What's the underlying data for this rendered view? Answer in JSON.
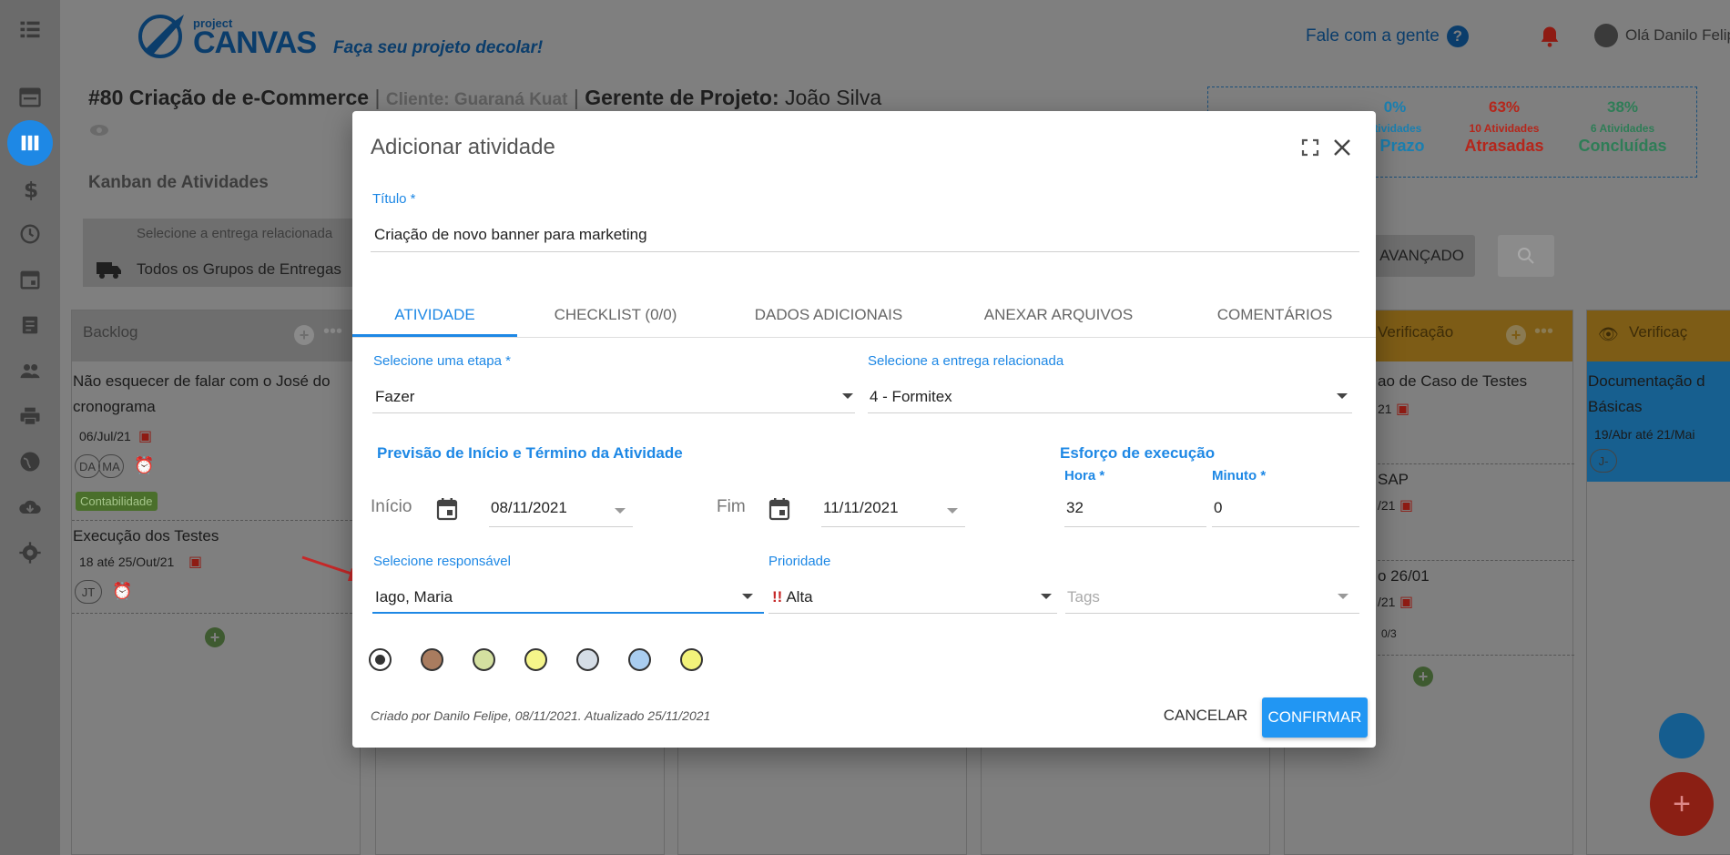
{
  "header": {
    "logo_small": "project",
    "logo_big": "CANVAS",
    "tagline": "Faça seu projeto decolar!",
    "contact": "Fale com a gente",
    "contact_icon": "help-circle-icon",
    "user": "Olá Danilo Felipe"
  },
  "project": {
    "number_title": "#80 Criação de e-Commerce",
    "client": "Cliente: Guaraná Kuat",
    "manager_label": "Gerente de Projeto:",
    "manager_name": "João Silva",
    "kanban_label": "Kanban de Atividades",
    "filter_label": "Selecione a entrega relacionada",
    "filter_value": "Todos os Grupos de Entregas"
  },
  "stats": [
    {
      "pct": "0%",
      "sub": "atividades",
      "label": "o Prazo",
      "color": "#1a7fb0"
    },
    {
      "pct": "63%",
      "sub": "10 Atividades",
      "label": "Atrasadas",
      "color": "#b5261b"
    },
    {
      "pct": "38%",
      "sub": "6 Atividades",
      "label": "Concluídas",
      "color": "#2f7d57"
    }
  ],
  "toolbar": {
    "advanced": "AVANÇADO"
  },
  "columns": {
    "backlog": {
      "title": "Backlog",
      "card1_line1": "Não esquecer de falar com o José do",
      "card1_line2": "cronograma",
      "card1_date": "06/Jul/21",
      "card1_avatar1": "DA",
      "card1_avatar2": "MA",
      "card1_tag": "Contabilidade",
      "card2_title": "Execução dos Testes",
      "card2_date": "18 até 25/Out/21",
      "card2_avatar": "JT"
    },
    "verificacao": {
      "title": "Verificação",
      "card1": "ao de Caso de Testes",
      "card1_date": "21",
      "card2": "SAP",
      "card2_date": "/21",
      "card3": "o 26/01",
      "card3_date": "/21",
      "card3_progress": "0/3"
    },
    "verificacao2": {
      "title": "Verificaç",
      "card1_line1": "Documentação d",
      "card1_line2": "Básicas",
      "card1_date": "19/Abr até 21/Mai",
      "card1_avatar": "J-"
    }
  },
  "modal": {
    "title": "Adicionar atividade",
    "titulo_label": "Título *",
    "titulo_value": "Criação de novo banner para marketing",
    "tabs": [
      "ATIVIDADE",
      "CHECKLIST (0/0)",
      "DADOS ADICIONAIS",
      "ANEXAR ARQUIVOS",
      "COMENTÁRIOS"
    ],
    "etapa_label": "Selecione uma etapa *",
    "etapa_value": "Fazer",
    "entrega_label": "Selecione a entrega relacionada",
    "entrega_value": "4 - Formitex",
    "previsao_title": "Previsão de Início e Término da Atividade",
    "inicio_label": "Início",
    "inicio_value": "08/11/2021",
    "fim_label": "Fim",
    "fim_value": "11/11/2021",
    "esforco_title": "Esforço de execução",
    "hora_label": "Hora *",
    "hora_value": "32",
    "minuto_label": "Minuto *",
    "minuto_value": "0",
    "responsavel_label": "Selecione responsável",
    "responsavel_value": "Iago, Maria",
    "prioridade_label": "Prioridade",
    "prioridade_mark": "!!",
    "prioridade_value": "Alta",
    "tags_placeholder": "Tags",
    "colors": [
      "#ffffff",
      "#a97c5f",
      "#d4e0a0",
      "#f5f58a",
      "#d5dde6",
      "#a9cdf0",
      "#f2f27a"
    ],
    "footer_note": "Criado por Danilo Felipe, 08/11/2021. Atualizado 25/11/2021",
    "cancel": "CANCELAR",
    "confirm": "CONFIRMAR"
  }
}
